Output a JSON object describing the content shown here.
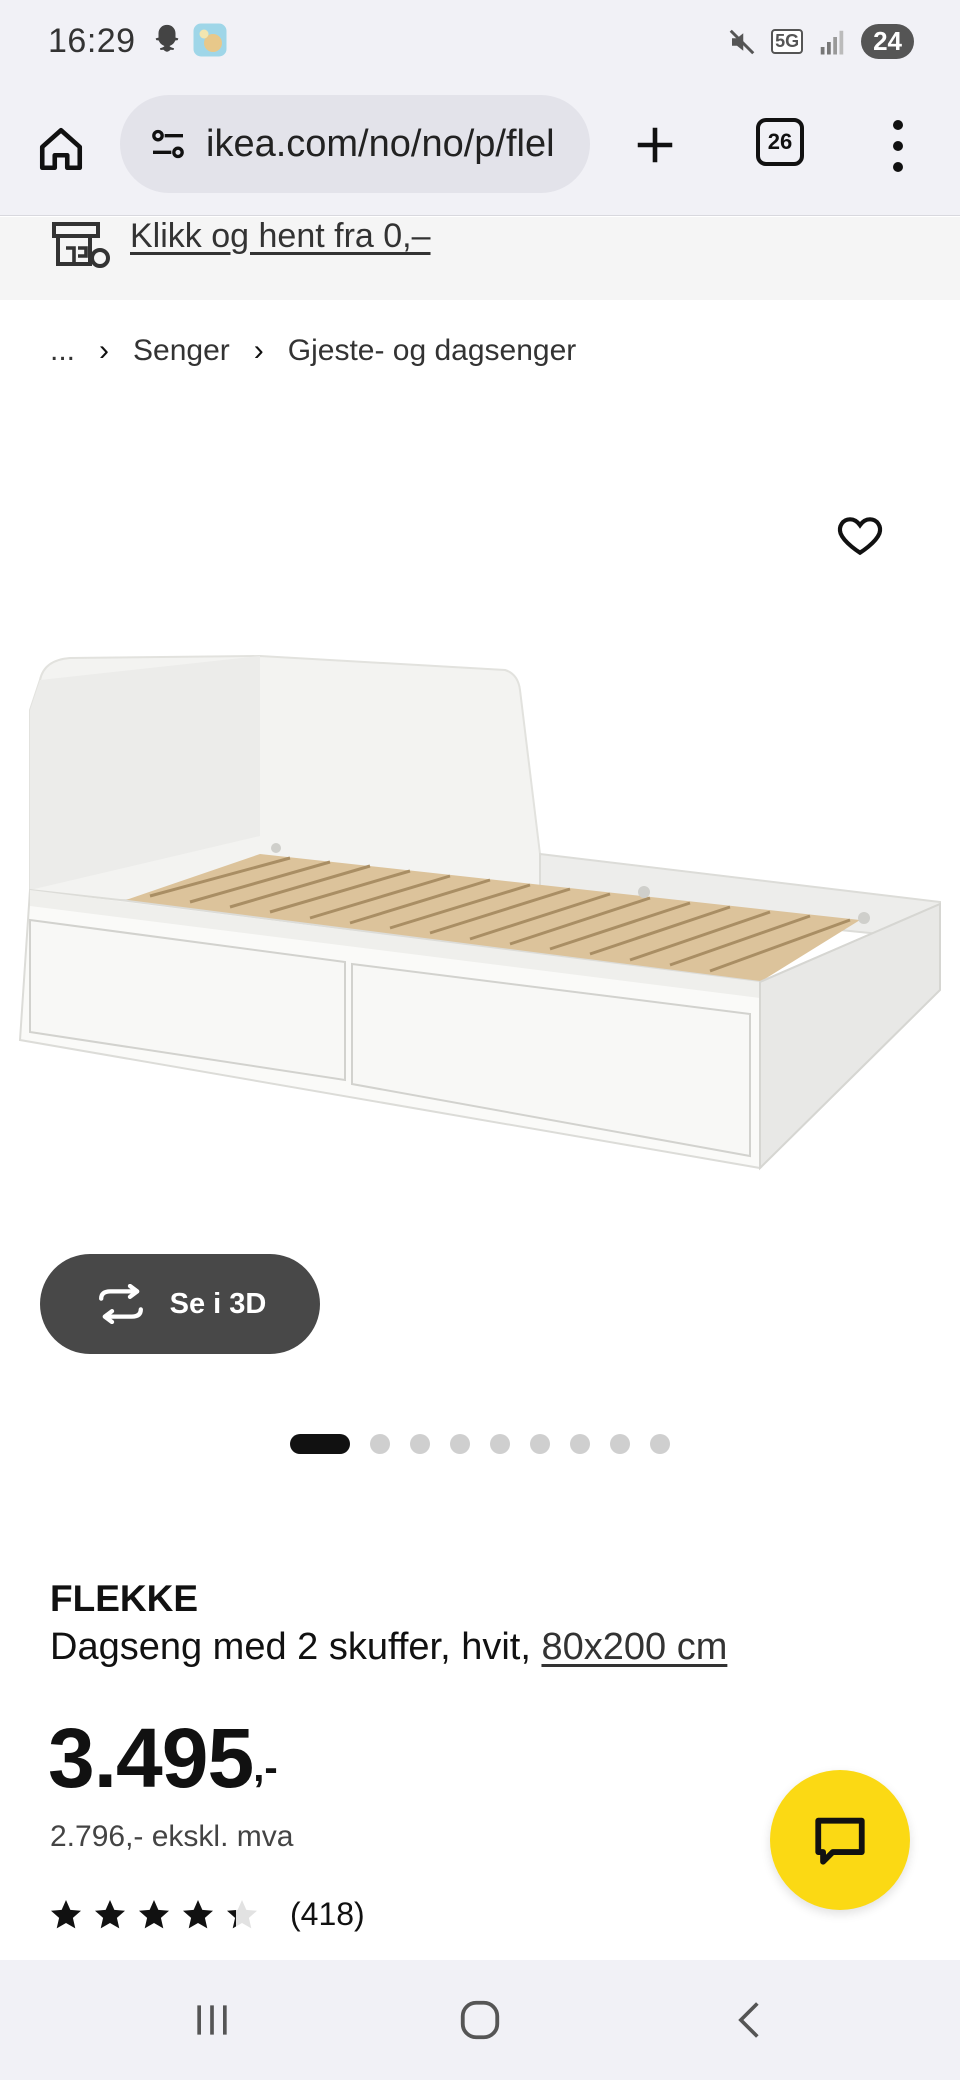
{
  "status_bar": {
    "time": "16:29",
    "network": "5G",
    "battery": "24"
  },
  "browser": {
    "url": "ikea.com/no/no/p/flel",
    "tab_count": "26"
  },
  "promo": {
    "text": "Klikk og hent fra 0,–"
  },
  "breadcrumb": {
    "items": [
      "...",
      "Senger",
      "Gjeste- og dagsenger"
    ]
  },
  "gallery": {
    "btn_3d_label": "Se i 3D",
    "image_count": 9,
    "active_index": 0
  },
  "product": {
    "brand": "FLEKKE",
    "description": "Dagseng med 2 skuffer, hvit,",
    "size": "80x200 cm",
    "price": "3.495",
    "price_suffix": ",-",
    "price_ex_vat": "2.796,- ekskl. mva",
    "rating_stars": 4,
    "rating_max": 5,
    "rating_count": "(418)"
  },
  "colors": {
    "chat_fab": "#fbd914",
    "btn_3d": "#484848",
    "system_bar": "#f1f1f6"
  },
  "icons": {
    "home": "home-icon",
    "site_settings": "tune-icon",
    "add_tab": "plus-icon",
    "menu": "more-vertical-icon",
    "favorite": "heart-icon",
    "rotate_3d": "rotate-3d-icon",
    "chat": "chat-icon"
  }
}
